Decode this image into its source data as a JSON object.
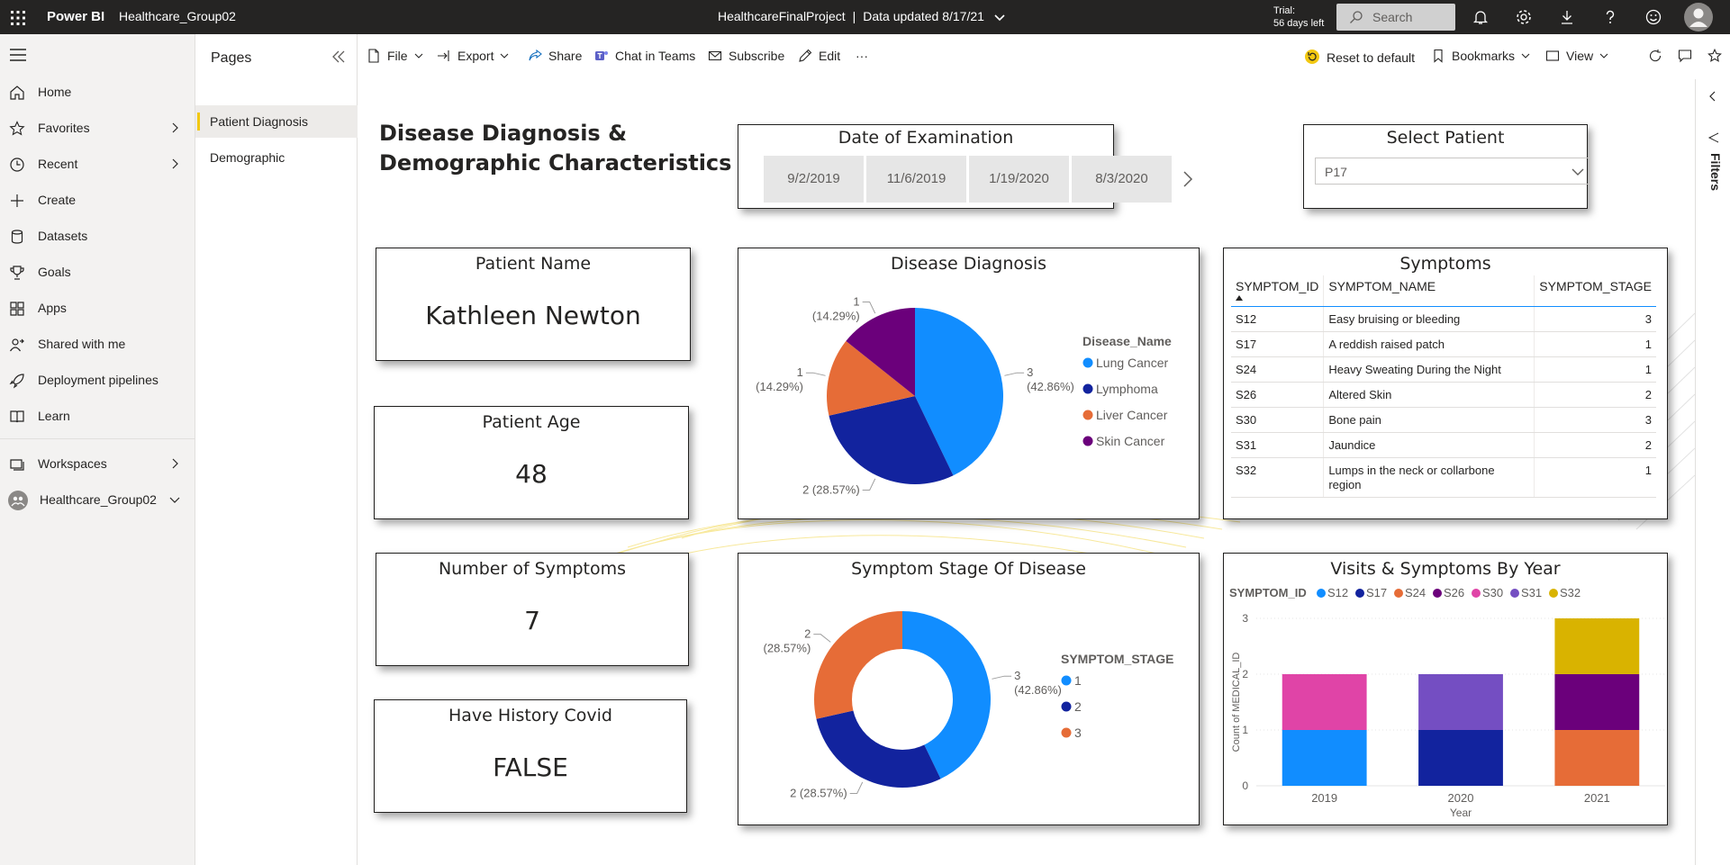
{
  "topbar": {
    "brand": "Power BI",
    "workspace": "Healthcare_Group02",
    "report_name": "HealthcareFinalProject",
    "separator": "|",
    "data_updated": "Data updated 8/17/21",
    "trial_line1": "Trial:",
    "trial_line2": "56 days left",
    "search_placeholder": "Search"
  },
  "leftnav": {
    "items": [
      {
        "label": "Home",
        "icon": "home-icon"
      },
      {
        "label": "Favorites",
        "icon": "star-icon"
      },
      {
        "label": "Recent",
        "icon": "clock-icon"
      },
      {
        "label": "Create",
        "icon": "plus-icon"
      },
      {
        "label": "Datasets",
        "icon": "database-icon"
      },
      {
        "label": "Goals",
        "icon": "trophy-icon"
      },
      {
        "label": "Apps",
        "icon": "apps-icon"
      },
      {
        "label": "Shared with me",
        "icon": "person-share-icon"
      },
      {
        "label": "Deployment pipelines",
        "icon": "rocket-icon"
      },
      {
        "label": "Learn",
        "icon": "book-icon"
      },
      {
        "label": "Workspaces",
        "icon": "workspaces-icon"
      },
      {
        "label": "Healthcare_Group02",
        "icon": "workspace-avatar-icon"
      }
    ]
  },
  "pages": {
    "title": "Pages",
    "items": [
      "Patient Diagnosis",
      "Demographic"
    ]
  },
  "actionbar": {
    "file": "File",
    "export": "Export",
    "share": "Share",
    "chat": "Chat in Teams",
    "subscribe": "Subscribe",
    "edit": "Edit",
    "more": "···",
    "reset": "Reset to default",
    "bookmarks": "Bookmarks",
    "view": "View"
  },
  "filters_label": "Filters",
  "report": {
    "title_line1": "Disease Diagnosis &",
    "title_line2": "Demographic Characteristics",
    "date_slicer": {
      "title": "Date of Examination",
      "dates": [
        "9/2/2019",
        "11/6/2019",
        "1/19/2020",
        "8/3/2020"
      ]
    },
    "select_patient": {
      "title": "Select Patient",
      "value": "P17"
    },
    "cards": {
      "patient_name": {
        "title": "Patient Name",
        "value": "Kathleen Newton"
      },
      "patient_age": {
        "title": "Patient Age",
        "value": "48"
      },
      "num_symptoms": {
        "title": "Number of Symptoms",
        "value": "7"
      },
      "covid_history": {
        "title": "Have History Covid",
        "value": "FALSE"
      }
    },
    "symptoms_table": {
      "title": "Symptoms",
      "columns": [
        "SYMPTOM_ID",
        "SYMPTOM_NAME",
        "SYMPTOM_STAGE"
      ],
      "rows": [
        [
          "S12",
          "Easy bruising or bleeding",
          "3"
        ],
        [
          "S17",
          "A reddish raised patch",
          "1"
        ],
        [
          "S24",
          "Heavy Sweating During the Night",
          "1"
        ],
        [
          "S26",
          "Altered Skin",
          "2"
        ],
        [
          "S30",
          "Bone pain",
          "3"
        ],
        [
          "S31",
          "Jaundice",
          "2"
        ],
        [
          "S32",
          "Lumps in the neck or collarbone region",
          "1"
        ]
      ]
    }
  },
  "chart_data": [
    {
      "type": "pie",
      "title": "Disease Diagnosis",
      "legend_title": "Disease_Name",
      "legend_position": "right",
      "categories": [
        "Lung Cancer",
        "Lymphoma",
        "Liver Cancer",
        "Skin Cancer"
      ],
      "values": [
        3,
        2,
        1,
        1
      ],
      "data_labels": [
        "3 (42.86%)",
        "2 (28.57%)",
        "1 (14.29%)",
        "1 (14.29%)"
      ],
      "colors": [
        "#118dff",
        "#12239e",
        "#e66c37",
        "#6b007b"
      ]
    },
    {
      "type": "pie",
      "subtype": "donut",
      "title": "Symptom Stage Of Disease",
      "legend_title": "SYMPTOM_STAGE",
      "legend_position": "right",
      "categories": [
        "1",
        "2",
        "3"
      ],
      "values": [
        3,
        2,
        2
      ],
      "data_labels": [
        "3 (42.86%)",
        "2 (28.57%)",
        "2 (28.57%)"
      ],
      "colors": [
        "#118dff",
        "#12239e",
        "#e66c37"
      ]
    },
    {
      "type": "bar",
      "stacked": true,
      "title": "Visits & Symptoms By Year",
      "legend_title": "SYMPTOM_ID",
      "legend_position": "top",
      "xlabel": "Year",
      "ylabel": "Count of MEDICAL_ID",
      "ylim": [
        0,
        3
      ],
      "yticks": [
        0,
        1,
        2,
        3
      ],
      "categories": [
        "2019",
        "2020",
        "2021"
      ],
      "series": [
        {
          "name": "S12",
          "color": "#118dff",
          "values": [
            1,
            0,
            0
          ]
        },
        {
          "name": "S17",
          "color": "#12239e",
          "values": [
            0,
            1,
            0
          ]
        },
        {
          "name": "S24",
          "color": "#e66c37",
          "values": [
            0,
            0,
            1
          ]
        },
        {
          "name": "S26",
          "color": "#6b007b",
          "values": [
            0,
            0,
            1
          ]
        },
        {
          "name": "S30",
          "color": "#e044a7",
          "values": [
            1,
            0,
            0
          ]
        },
        {
          "name": "S31",
          "color": "#744ec2",
          "values": [
            0,
            1,
            0
          ]
        },
        {
          "name": "S32",
          "color": "#d9b300",
          "values": [
            0,
            0,
            1
          ]
        }
      ]
    }
  ]
}
